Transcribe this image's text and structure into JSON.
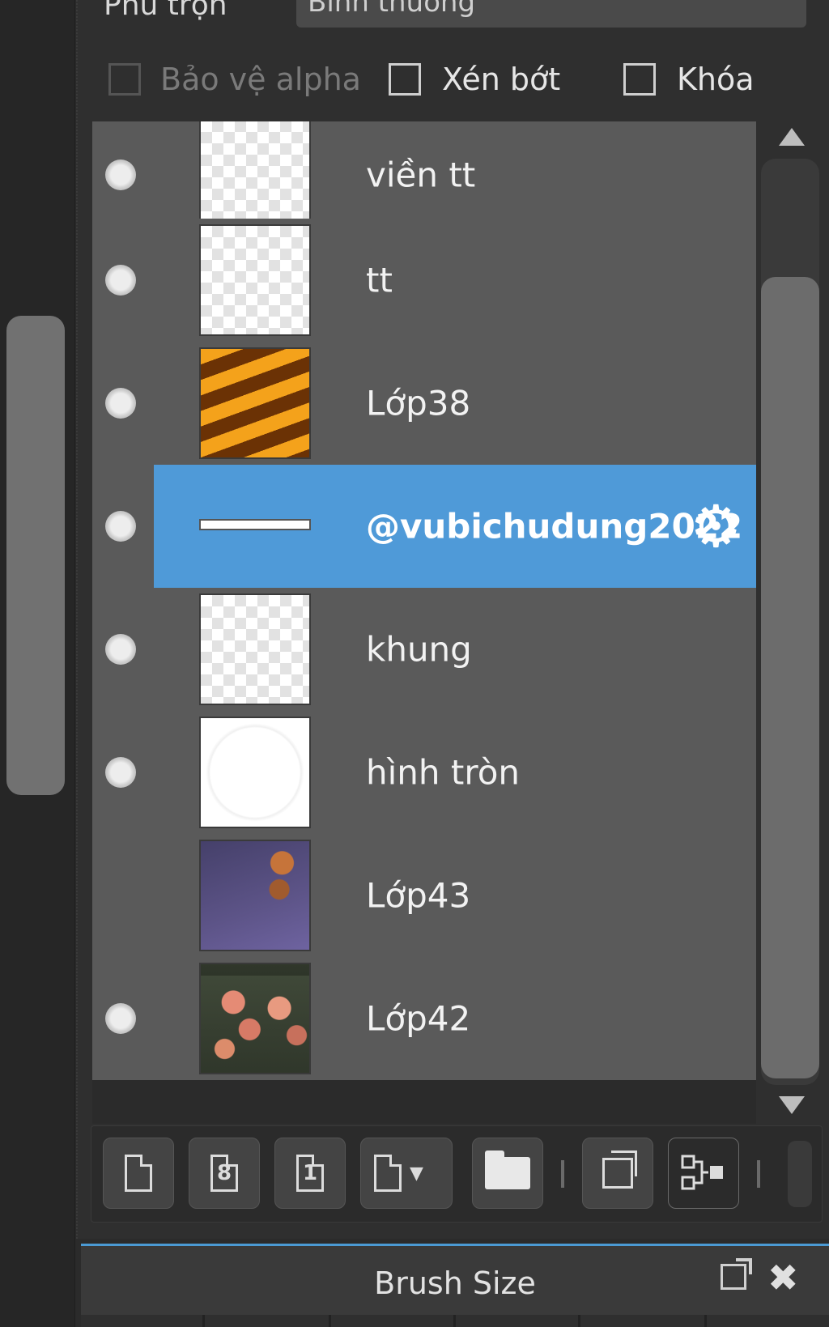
{
  "layers_panel": {
    "blend_mode": {
      "label": "Phủ trộn",
      "value": "Bình thường"
    },
    "options": {
      "protect_alpha": "Bảo vệ alpha",
      "clipping": "Xén bớt",
      "lock": "Khóa"
    },
    "layers": [
      {
        "name": "viền tt",
        "visible": true,
        "thumbnail": "transparent"
      },
      {
        "name": "tt",
        "visible": true,
        "thumbnail": "transparent"
      },
      {
        "name": "Lớp38",
        "visible": true,
        "thumbnail": "orange-stripes"
      },
      {
        "name": "@vubichudung2022",
        "visible": true,
        "thumbnail": "white-line",
        "selected": true
      },
      {
        "name": "khung",
        "visible": true,
        "thumbnail": "transparent"
      },
      {
        "name": "hình tròn",
        "visible": true,
        "thumbnail": "white-circle"
      },
      {
        "name": "Lớp43",
        "visible": false,
        "thumbnail": "purple-night-flowers"
      },
      {
        "name": "Lớp42",
        "visible": true,
        "thumbnail": "tulips-photo"
      }
    ],
    "toolbar_icons": [
      "new-layer-icon",
      "new-8bit-layer-icon",
      "new-1bit-layer-icon",
      "add-layer-dropdown-icon",
      "new-folder-icon",
      "duplicate-layer-icon",
      "merge-layer-icon"
    ]
  },
  "brush_size_panel": {
    "title": "Brush Size"
  },
  "colors": {
    "panel_bg": "#2f2f2f",
    "row_bg": "#5a5a5a",
    "selected_bg": "#4f9ad8",
    "accent_border": "#4b9ad4"
  }
}
